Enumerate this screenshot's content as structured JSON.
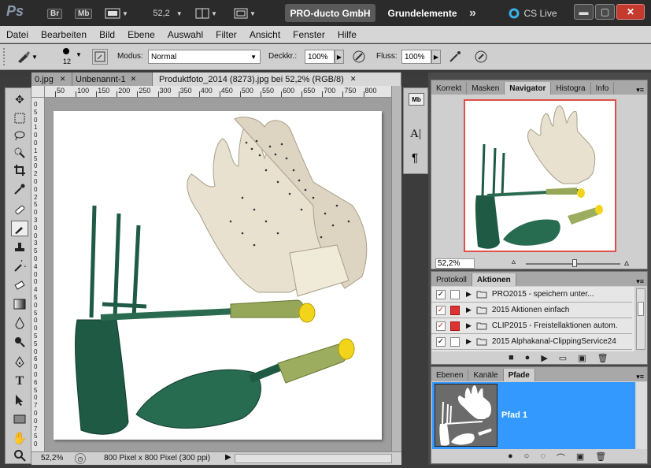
{
  "app": {
    "logo": "Ps",
    "bridge_label": "Br",
    "minibridge_label": "Mb",
    "zoom_value": "52,2",
    "workspace_active": "PRO-ducto GmbH",
    "workspace_other": "Grundelemente",
    "more_glyph": "»",
    "cslive_label": "CS Live"
  },
  "menu": [
    "Datei",
    "Bearbeiten",
    "Bild",
    "Ebene",
    "Auswahl",
    "Filter",
    "Ansicht",
    "Fenster",
    "Hilfe"
  ],
  "options": {
    "brush_size": "12",
    "mode_label": "Modus:",
    "mode_value": "Normal",
    "opacity_label": "Deckkr.:",
    "opacity_value": "100%",
    "flow_label": "Fluss:",
    "flow_value": "100%"
  },
  "doc_tabs": [
    {
      "label": "0.jpg"
    },
    {
      "label": "Unbenannt-1"
    },
    {
      "label": "Produktfoto_2014 (8273).jpg bei 52,2% (RGB/8)"
    }
  ],
  "ruler_top": [
    "50",
    "100",
    "150",
    "200",
    "250",
    "300",
    "350",
    "400",
    "450",
    "500",
    "550",
    "600",
    "650",
    "700",
    "750",
    "800"
  ],
  "ruler_left": [
    "0",
    "5",
    "0",
    "1",
    "0",
    "0",
    "1",
    "5",
    "0",
    "2",
    "0",
    "0",
    "2",
    "5",
    "0",
    "3",
    "0",
    "0",
    "3",
    "5",
    "0",
    "4",
    "0",
    "0",
    "4",
    "5",
    "0",
    "5",
    "0",
    "0",
    "5",
    "5",
    "0",
    "6",
    "0",
    "0",
    "6",
    "5",
    "0",
    "7",
    "0",
    "0",
    "7",
    "5",
    "0"
  ],
  "status": {
    "zoom": "52,2%",
    "doc_size": "800 Pixel x 800 Pixel (300 ppi)"
  },
  "navigator": {
    "tabs": [
      "Korrekt",
      "Masken",
      "Navigator",
      "Histogra",
      "Info"
    ],
    "active_tab": "Navigator",
    "zoom": "52,2%",
    "slider_level_percent": 52
  },
  "actions": {
    "tabs": [
      "Protokoll",
      "Aktionen"
    ],
    "active_tab": "Aktionen",
    "rows": [
      {
        "label": "PRO2015 - speichern unter...",
        "red": false
      },
      {
        "label": "2015 Aktionen einfach",
        "red": true
      },
      {
        "label": "CLIP2015 - Freistellaktionen autom.",
        "red": true
      },
      {
        "label": "2015 Alphakanal-ClippingService24",
        "red": false
      }
    ]
  },
  "layers": {
    "tabs": [
      "Ebenen",
      "Kanäle",
      "Pfade"
    ],
    "active_tab": "Pfade",
    "path_name": "Pfad 1"
  },
  "colors": {
    "accent": "#3399ff",
    "navigator_frame": "#e0504a"
  }
}
